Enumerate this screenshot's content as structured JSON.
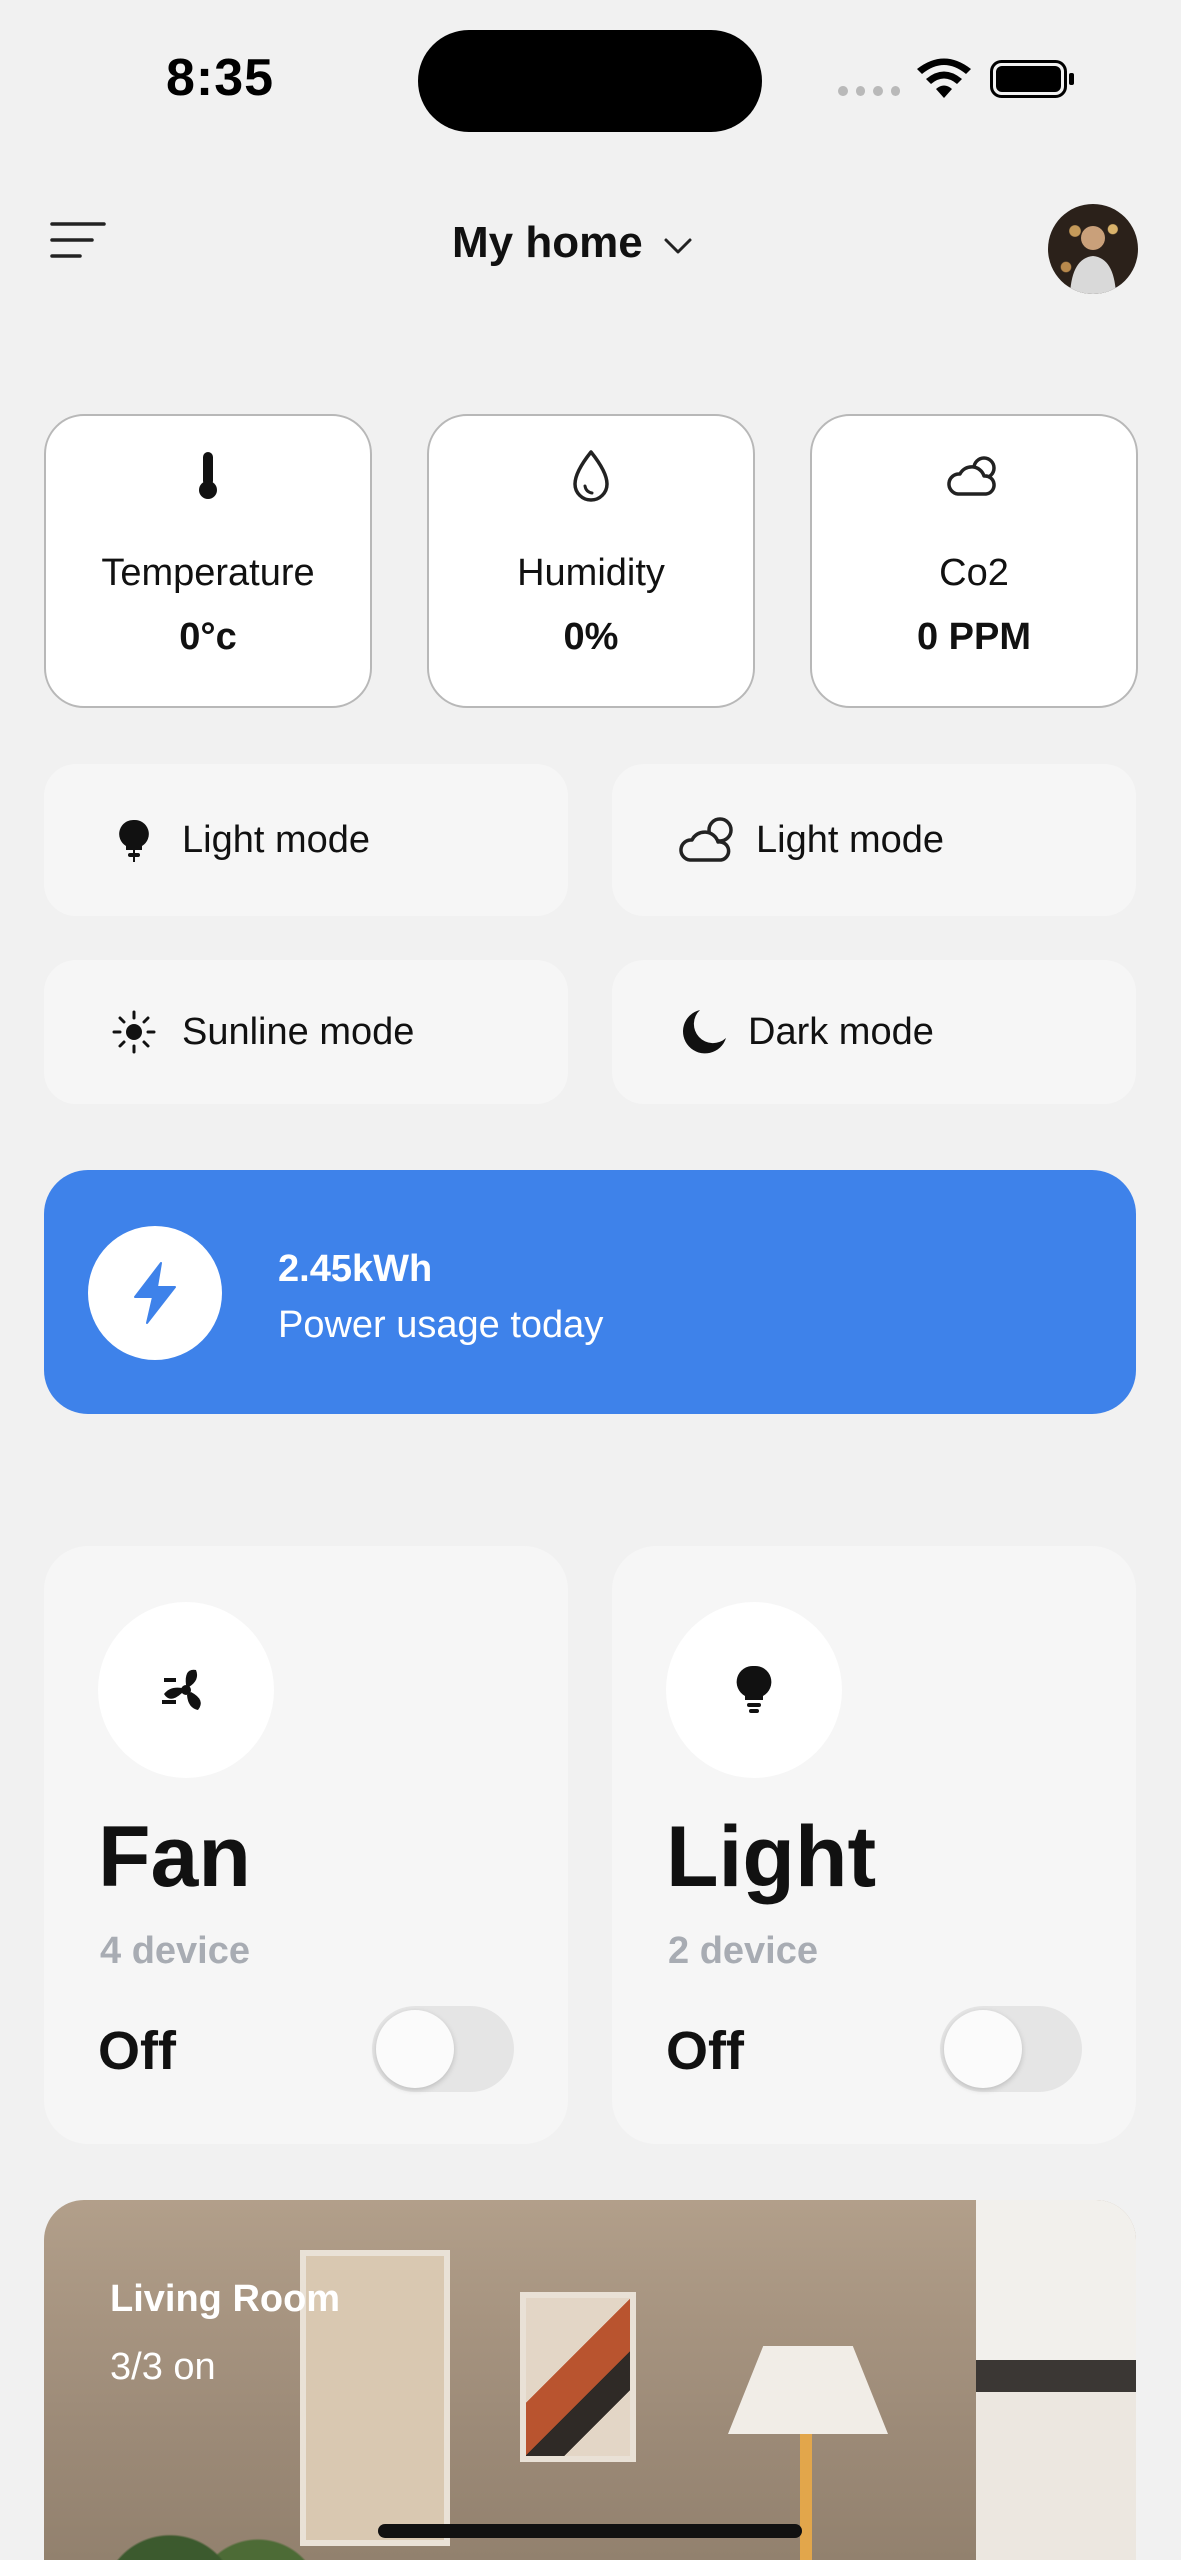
{
  "status_bar": {
    "time": "8:35"
  },
  "header": {
    "title": "My home"
  },
  "metrics": [
    {
      "label": "Temperature",
      "value": "0°c",
      "icon": "thermometer-icon"
    },
    {
      "label": "Humidity",
      "value": "0%",
      "icon": "droplet-icon"
    },
    {
      "label": "Co2",
      "value": "0 PPM",
      "icon": "cloud-sun-icon"
    }
  ],
  "modes": [
    {
      "label": "Light mode",
      "icon": "bulb-icon"
    },
    {
      "label": "Light mode",
      "icon": "cloud-sun-icon"
    },
    {
      "label": "Sunline mode",
      "icon": "sun-icon"
    },
    {
      "label": "Dark mode",
      "icon": "moon-icon"
    }
  ],
  "power": {
    "value": "2.45kWh",
    "caption": "Power usage today",
    "accent": "#3e82ea"
  },
  "devices": [
    {
      "name": "Fan",
      "count": "4 device",
      "state": "Off",
      "on": false,
      "icon": "fan-icon"
    },
    {
      "name": "Light",
      "count": "2 device",
      "state": "Off",
      "on": false,
      "icon": "bulb-icon"
    }
  ],
  "room": {
    "name": "Living Room",
    "status": "3/3 on"
  }
}
